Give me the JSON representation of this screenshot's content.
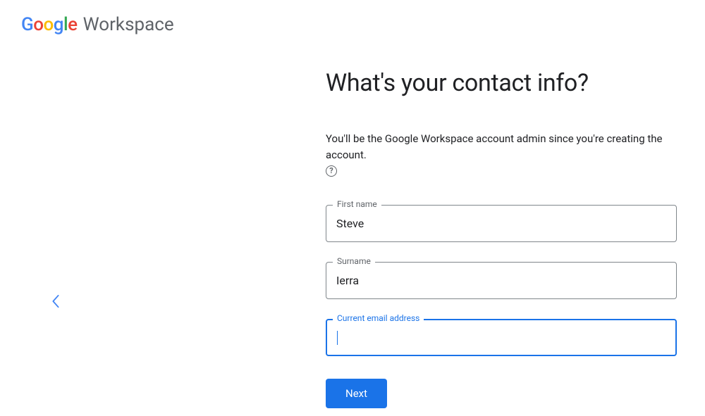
{
  "header": {
    "logo_product": "Workspace"
  },
  "navigation": {
    "back_icon_name": "chevron-left-icon"
  },
  "main": {
    "title": "What's your contact info?",
    "subtitle": "You'll be the Google Workspace account admin since you're creating the account.",
    "help_icon_name": "help-circle-icon",
    "fields": {
      "first_name": {
        "label": "First name",
        "value": "Steve"
      },
      "surname": {
        "label": "Surname",
        "value": "Ierra"
      },
      "email": {
        "label": "Current email address",
        "value": ""
      }
    },
    "next_button": "Next"
  }
}
